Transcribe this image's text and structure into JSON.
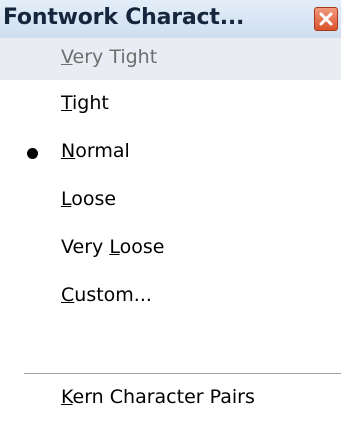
{
  "window": {
    "title": "Fontwork Charact...",
    "close_icon": "close-icon"
  },
  "menu": {
    "items": [
      {
        "pre": "",
        "mnemonic": "V",
        "post": "ery Tight",
        "highlighted": true,
        "disabled": true,
        "checked": false
      },
      {
        "pre": "",
        "mnemonic": "T",
        "post": "ight",
        "highlighted": false,
        "disabled": false,
        "checked": false
      },
      {
        "pre": "",
        "mnemonic": "N",
        "post": "ormal",
        "highlighted": false,
        "disabled": false,
        "checked": true
      },
      {
        "pre": "",
        "mnemonic": "L",
        "post": "oose",
        "highlighted": false,
        "disabled": false,
        "checked": false
      },
      {
        "pre": "Very ",
        "mnemonic": "L",
        "post": "oose",
        "highlighted": false,
        "disabled": false,
        "checked": false
      },
      {
        "pre": "",
        "mnemonic": "C",
        "post": "ustom...",
        "highlighted": false,
        "disabled": false,
        "checked": false
      },
      {
        "pre": "",
        "mnemonic": "K",
        "post": "ern Character Pairs",
        "highlighted": false,
        "disabled": false,
        "checked": false
      }
    ]
  },
  "colors": {
    "highlight": "#e9edf3",
    "close_button": "#d9532c",
    "title_text": "#15263d"
  }
}
